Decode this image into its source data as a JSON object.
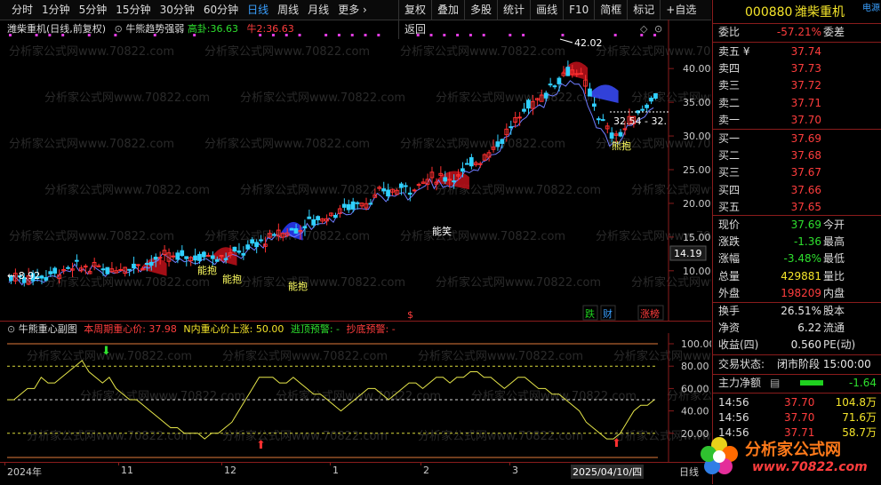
{
  "toolbar": {
    "periods": [
      "分时",
      "1分钟",
      "5分钟",
      "15分钟",
      "30分钟",
      "60分钟",
      "日线",
      "周线",
      "月线",
      "更多 ›"
    ],
    "active_period": "日线",
    "tools": [
      "复权",
      "叠加",
      "多股",
      "统计",
      "画线",
      "F10",
      "简框",
      "标记",
      "+自选",
      "返回"
    ]
  },
  "stock": {
    "code": "000880",
    "name": "潍柴重机",
    "source": "电源"
  },
  "main_header": {
    "title": "潍柴重机(日线,前复权)",
    "indicator": "牛熊趋势强弱",
    "line1_label": "高卦:",
    "line1_value": "36.63",
    "line2_label": "牛2:",
    "line2_value": "36.63"
  },
  "main_chart": {
    "price_axis": [
      "40.00",
      "35.00",
      "30.00",
      "25.00",
      "20.00",
      "15.00",
      "10.00"
    ],
    "crosshair_price": "14.19",
    "high_label": "42.02",
    "low_label": "8.92",
    "last_label": "32.54 - 32.",
    "annotations": [
      "能抱",
      "能抱",
      "能抱",
      "能笑",
      "熊抱"
    ],
    "bottom_tags": [
      "$",
      "跌",
      "财",
      "涨榜"
    ]
  },
  "sub_header": {
    "title": "牛熊重心副图",
    "item1": "本周期重心价: 37.98",
    "item2": "N内重心价上涨: 50.00",
    "item3": "逃顶预警: -",
    "item4": "抄底预警: -"
  },
  "sub_axis": [
    "100.00",
    "80.00",
    "60.00",
    "40.00",
    "20.00"
  ],
  "xaxis": [
    "2024年",
    "11",
    "12",
    "1",
    "2",
    "3",
    "2025/04/10/四",
    "日线"
  ],
  "watermark": "分析家公式网www.70822.com",
  "quote": {
    "weibi_label": "委比",
    "weibi": "-57.21%",
    "weicha_label": "委差",
    "asks": [
      [
        "卖五 ¥",
        "37.74"
      ],
      [
        "卖四",
        "37.73"
      ],
      [
        "卖三",
        "37.72"
      ],
      [
        "卖二",
        "37.71"
      ],
      [
        "卖一",
        "37.70"
      ]
    ],
    "bids": [
      [
        "买一",
        "37.69"
      ],
      [
        "买二",
        "37.68"
      ],
      [
        "买三",
        "37.67"
      ],
      [
        "买四",
        "37.66"
      ],
      [
        "买五",
        "37.65"
      ]
    ],
    "xianjia_label": "现价",
    "xianjia": "37.69",
    "jinkai": "今开",
    "zhangdie_label": "涨跌",
    "zhangdie": "-1.36",
    "zuigao": "最高",
    "zhangfu_label": "涨幅",
    "zhangfu": "-3.48%",
    "zuidi": "最低",
    "zongliang_label": "总量",
    "zongliang": "429881",
    "liangbi": "量比",
    "waipan_label": "外盘",
    "waipan": "198209",
    "neipan": "内盘",
    "huanshou_label": "换手",
    "huanshou": "26.51%",
    "guben": "股本",
    "jingzi_label": "净资",
    "jingzi": "6.22",
    "liutong": "流通",
    "shouyi_label": "收益(四)",
    "shouyi": "0.560",
    "pe": "PE(动)",
    "status_label": "交易状态:",
    "status": "闭市阶段 15:00:00",
    "zhuli_label": "主力净额",
    "zhuli": "-1.64",
    "ticks": [
      [
        "14:56",
        "37.70",
        "104.8万"
      ],
      [
        "14:56",
        "37.70",
        "71.6万"
      ],
      [
        "14:56",
        "37.71",
        "58.7万"
      ]
    ]
  },
  "logo": {
    "text": "分析家公式网",
    "url": "www.70822.com"
  }
}
